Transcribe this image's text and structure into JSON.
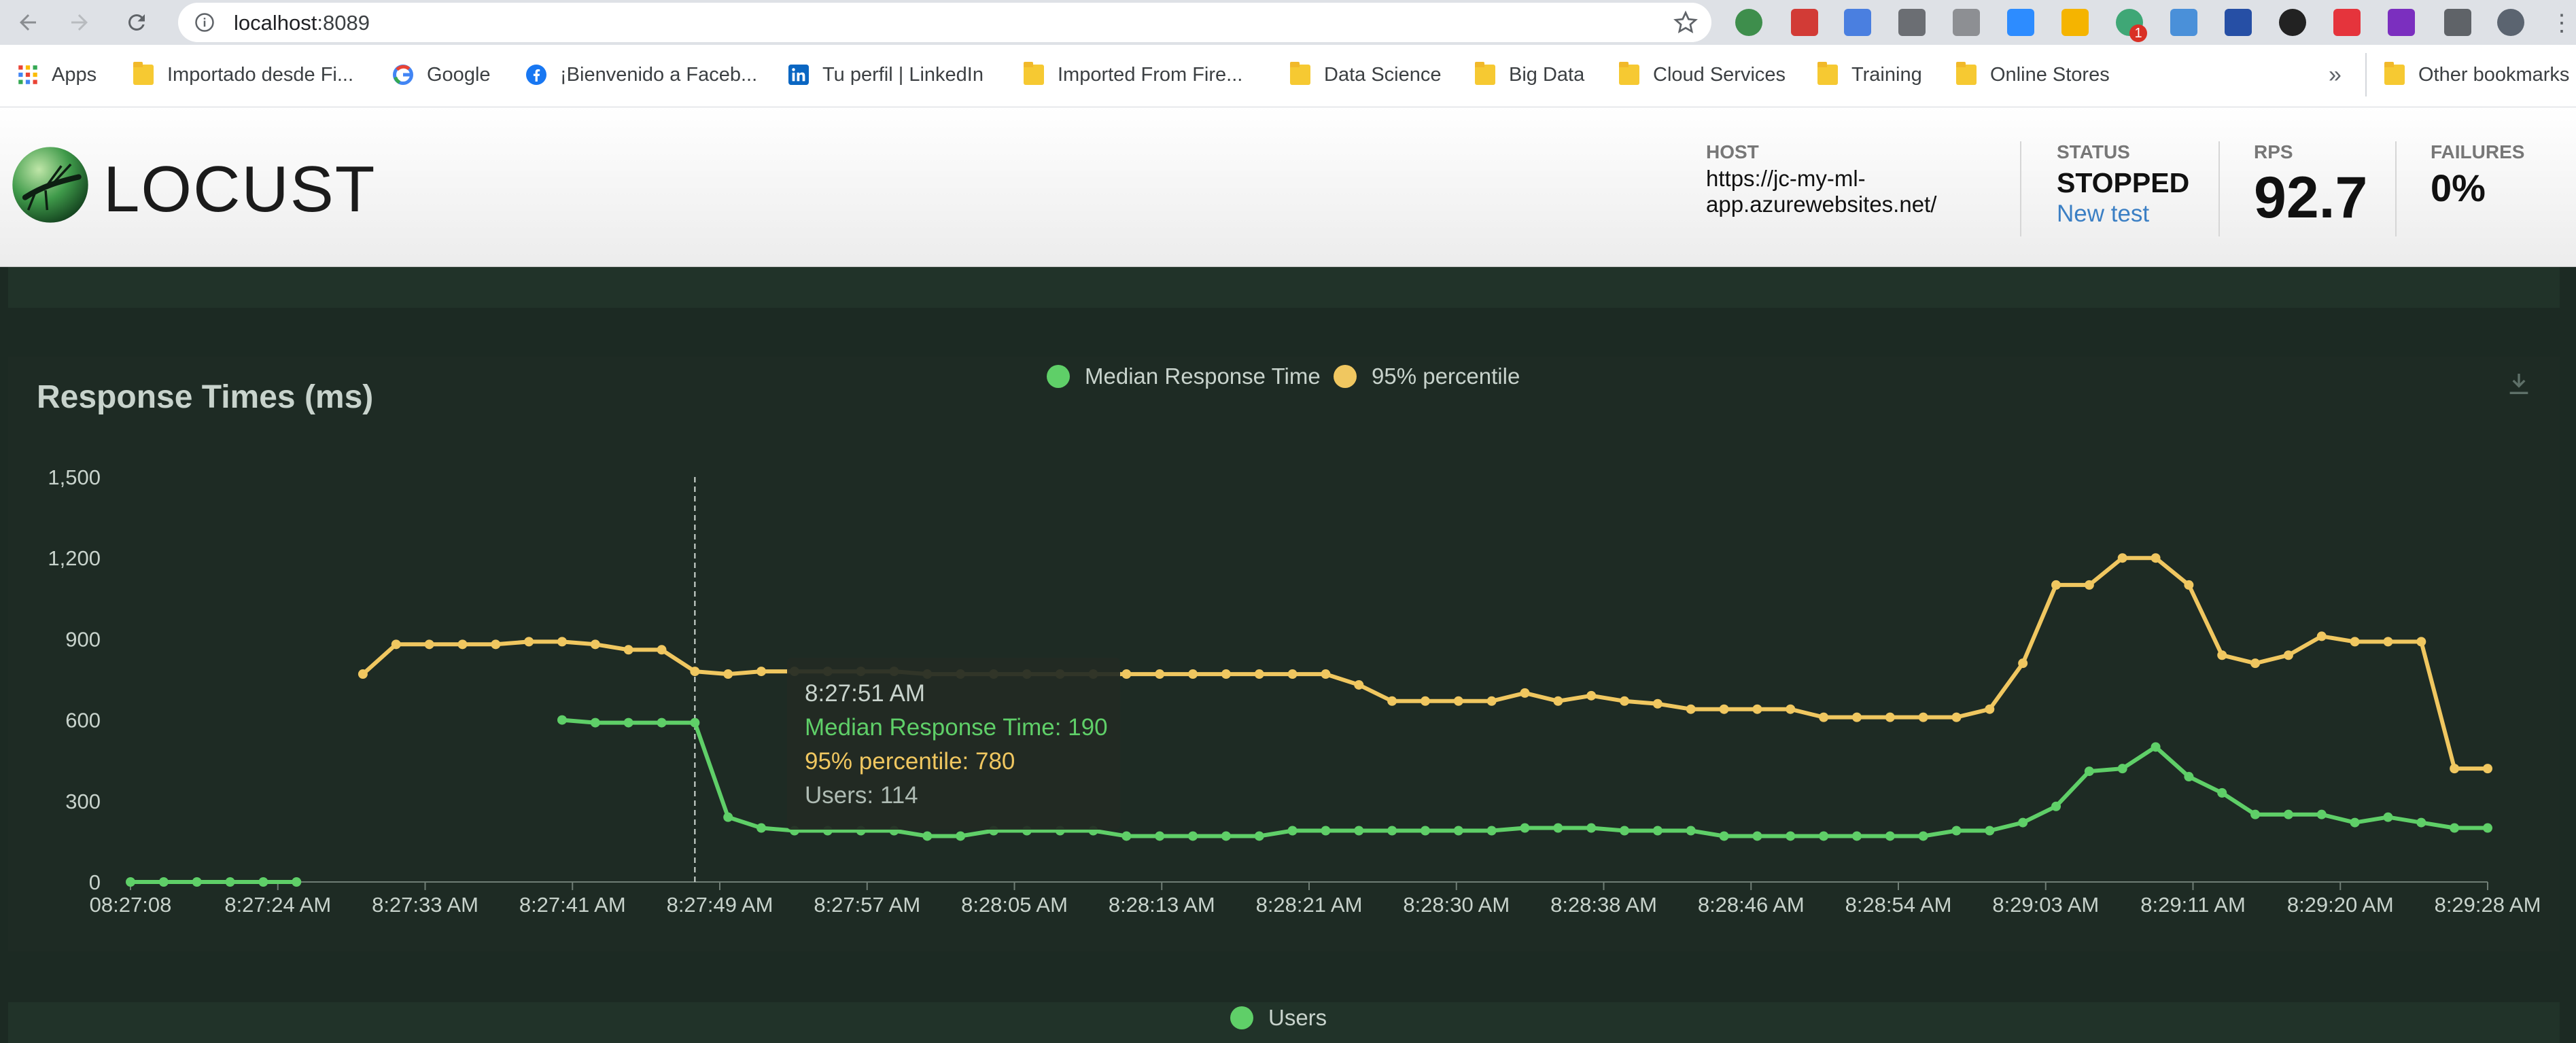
{
  "browser": {
    "url_host": "localhost",
    "url_port": ":8089",
    "bookmarks": [
      {
        "label": "Apps",
        "icon": "apps-grid-icon"
      },
      {
        "label": "Importado desde Fi...",
        "icon": "folder-icon"
      },
      {
        "label": "Google",
        "icon": "google-icon"
      },
      {
        "label": "¡Bienvenido a Faceb...",
        "icon": "facebook-icon"
      },
      {
        "label": "Tu perfil | LinkedIn",
        "icon": "linkedin-icon"
      },
      {
        "label": "Imported From Fire...",
        "icon": "folder-icon"
      },
      {
        "label": "Data Science",
        "icon": "folder-icon"
      },
      {
        "label": "Big Data",
        "icon": "folder-icon"
      },
      {
        "label": "Cloud Services",
        "icon": "folder-icon"
      },
      {
        "label": "Training",
        "icon": "folder-icon"
      },
      {
        "label": "Online Stores",
        "icon": "folder-icon"
      },
      {
        "label": "Other bookmarks",
        "icon": "folder-icon"
      }
    ],
    "overflow": "»",
    "extension_badge": "1"
  },
  "locust": {
    "logo_text": "LOCUST",
    "host_label": "HOST",
    "host_value": "https://jc-my-ml-app.azurewebsites.net/",
    "status_label": "STATUS",
    "status_value": "STOPPED",
    "new_test": "New test",
    "rps_label": "RPS",
    "rps_value": "92.7",
    "failures_label": "FAILURES",
    "failures_value": "0%"
  },
  "next_panel": {
    "legend": "Users"
  },
  "tooltip": {
    "time": "8:27:51 AM",
    "median": "Median Response Time: 190",
    "p95": "95% percentile: 780",
    "users": "Users: 114"
  },
  "chart_data": {
    "type": "line",
    "title": "Response Times (ms)",
    "ylim": [
      0,
      1500
    ],
    "yticks": [
      "0",
      "300",
      "600",
      "900",
      "1,200",
      "1,500"
    ],
    "xticks": [
      "08:27:08",
      "8:27:24 AM",
      "8:27:33 AM",
      "8:27:41 AM",
      "8:27:49 AM",
      "8:27:57 AM",
      "8:28:05 AM",
      "8:28:13 AM",
      "8:28:21 AM",
      "8:28:30 AM",
      "8:28:38 AM",
      "8:28:46 AM",
      "8:28:54 AM",
      "8:29:03 AM",
      "8:29:11 AM",
      "8:29:20 AM",
      "8:29:28 AM"
    ],
    "legend_position": "top-center",
    "grid": false,
    "colors": {
      "median": "#5fcf68",
      "p95": "#f0c760"
    },
    "highlight_index": 17,
    "series": [
      {
        "name": "Median Response Time",
        "values": [
          0,
          0,
          0,
          0,
          0,
          0,
          null,
          null,
          null,
          null,
          null,
          null,
          null,
          600,
          590,
          590,
          590,
          590,
          240,
          200,
          190,
          190,
          190,
          190,
          170,
          170,
          190,
          190,
          190,
          190,
          170,
          170,
          170,
          170,
          170,
          190,
          190,
          190,
          190,
          190,
          190,
          190,
          200,
          200,
          200,
          190,
          190,
          190,
          170,
          170,
          170,
          170,
          170,
          170,
          170,
          190,
          190,
          220,
          280,
          410,
          420,
          500,
          390,
          330,
          250,
          250,
          250,
          220,
          240,
          220,
          200,
          200
        ]
      },
      {
        "name": "95% percentile",
        "values": [
          null,
          null,
          null,
          null,
          null,
          null,
          null,
          770,
          880,
          880,
          880,
          880,
          890,
          890,
          880,
          860,
          860,
          780,
          770,
          780,
          780,
          780,
          780,
          780,
          770,
          770,
          770,
          770,
          770,
          770,
          770,
          770,
          770,
          770,
          770,
          770,
          770,
          730,
          670,
          670,
          670,
          670,
          700,
          670,
          690,
          670,
          660,
          640,
          640,
          640,
          640,
          610,
          610,
          610,
          610,
          610,
          640,
          810,
          1100,
          1100,
          1200,
          1200,
          1100,
          840,
          810,
          840,
          910,
          890,
          890,
          890,
          420,
          420
        ]
      }
    ]
  }
}
